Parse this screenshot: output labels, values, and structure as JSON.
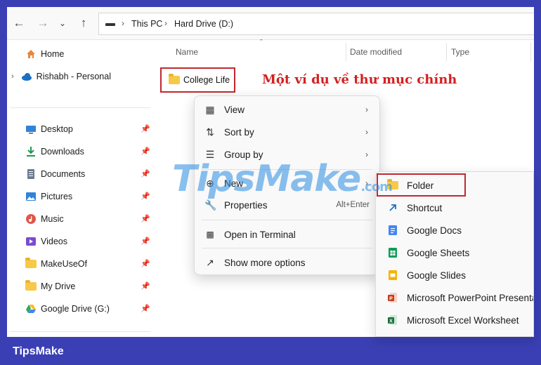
{
  "address": {
    "segments": [
      "This PC",
      "Hard Drive (D:)"
    ]
  },
  "sidebar": {
    "home": "Home",
    "personal": "Rishabh - Personal",
    "items": [
      {
        "label": "Desktop",
        "icon": "desktop-icon",
        "color": "#2f84d8"
      },
      {
        "label": "Downloads",
        "icon": "download-icon",
        "color": "#1f9a4d"
      },
      {
        "label": "Documents",
        "icon": "documents-icon",
        "color": "#6b7a8f"
      },
      {
        "label": "Pictures",
        "icon": "pictures-icon",
        "color": "#2f84d8"
      },
      {
        "label": "Music",
        "icon": "music-icon",
        "color": "#e0564a"
      },
      {
        "label": "Videos",
        "icon": "videos-icon",
        "color": "#7b4bd1"
      },
      {
        "label": "MakeUseOf",
        "icon": "folder-icon",
        "color": "#f7c948"
      },
      {
        "label": "My Drive",
        "icon": "folder-icon",
        "color": "#f7c948"
      },
      {
        "label": "Google Drive (G:)",
        "icon": "google-drive-icon",
        "color": "#34a853"
      }
    ]
  },
  "columns": {
    "name": "Name",
    "date": "Date modified",
    "type": "Type"
  },
  "folder": {
    "name": "College Life"
  },
  "annotation": "Một ví dụ về thư mục chính",
  "context_menu": {
    "view": "View",
    "sort": "Sort by",
    "group": "Group by",
    "new": "New",
    "properties": "Properties",
    "properties_shortcut": "Alt+Enter",
    "terminal": "Open in Terminal",
    "more": "Show more options"
  },
  "submenu": {
    "items": [
      "Folder",
      "Shortcut",
      "Google Docs",
      "Google Sheets",
      "Google Slides",
      "Microsoft PowerPoint Presentation",
      "Microsoft Excel Worksheet"
    ]
  },
  "watermark": {
    "text": "TipsMake",
    "suffix": ".com"
  },
  "brand": "TipsMake",
  "colors": {
    "frame": "#3a3fb4",
    "highlight": "#c0282f",
    "annotation": "#d41f1f"
  }
}
